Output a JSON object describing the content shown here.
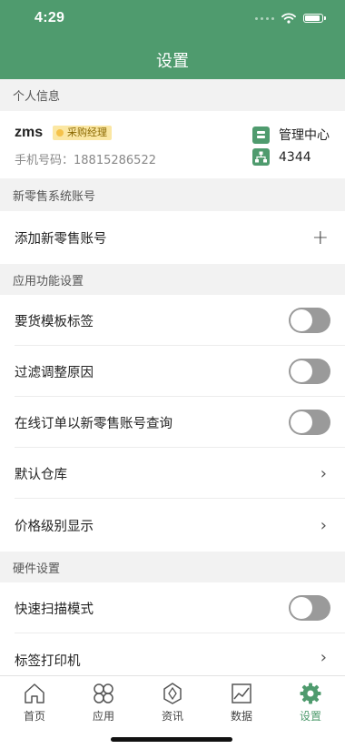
{
  "status_bar": {
    "time": "4:29"
  },
  "header": {
    "title": "设置"
  },
  "sections": {
    "personal": "个人信息",
    "retail_account": "新零售系统账号",
    "app_features": "应用功能设置",
    "hardware": "硬件设置"
  },
  "profile": {
    "name": "zms",
    "role": "采购经理",
    "phone": "手机号码：18815286522",
    "org_items": [
      {
        "label": "管理中心",
        "icon": "building-icon"
      },
      {
        "label": "4344",
        "icon": "org-tree-icon"
      }
    ]
  },
  "retail": {
    "add_label": "添加新零售账号"
  },
  "features": [
    {
      "label": "要货模板标签",
      "control": "toggle",
      "on": false
    },
    {
      "label": "过滤调整原因",
      "control": "toggle",
      "on": false
    },
    {
      "label": "在线订单以新零售账号查询",
      "control": "toggle",
      "on": false
    },
    {
      "label": "默认仓库",
      "control": "chevron"
    },
    {
      "label": "价格级别显示",
      "control": "chevron"
    }
  ],
  "hardware": [
    {
      "label": "快速扫描模式",
      "control": "toggle",
      "on": false
    },
    {
      "label": "标签打印机",
      "control": "chevron"
    }
  ],
  "tabbar": [
    {
      "label": "首页",
      "icon": "home-icon",
      "active": false
    },
    {
      "label": "应用",
      "icon": "apps-icon",
      "active": false
    },
    {
      "label": "资讯",
      "icon": "news-icon",
      "active": false
    },
    {
      "label": "数据",
      "icon": "chart-icon",
      "active": false
    },
    {
      "label": "设置",
      "icon": "gear-icon",
      "active": true
    }
  ],
  "colors": {
    "brand": "#4f9b6e",
    "toggle_off": "#9a9a9a",
    "section_bg": "#f2f2f2",
    "badge_bg": "#fbe7a3"
  }
}
